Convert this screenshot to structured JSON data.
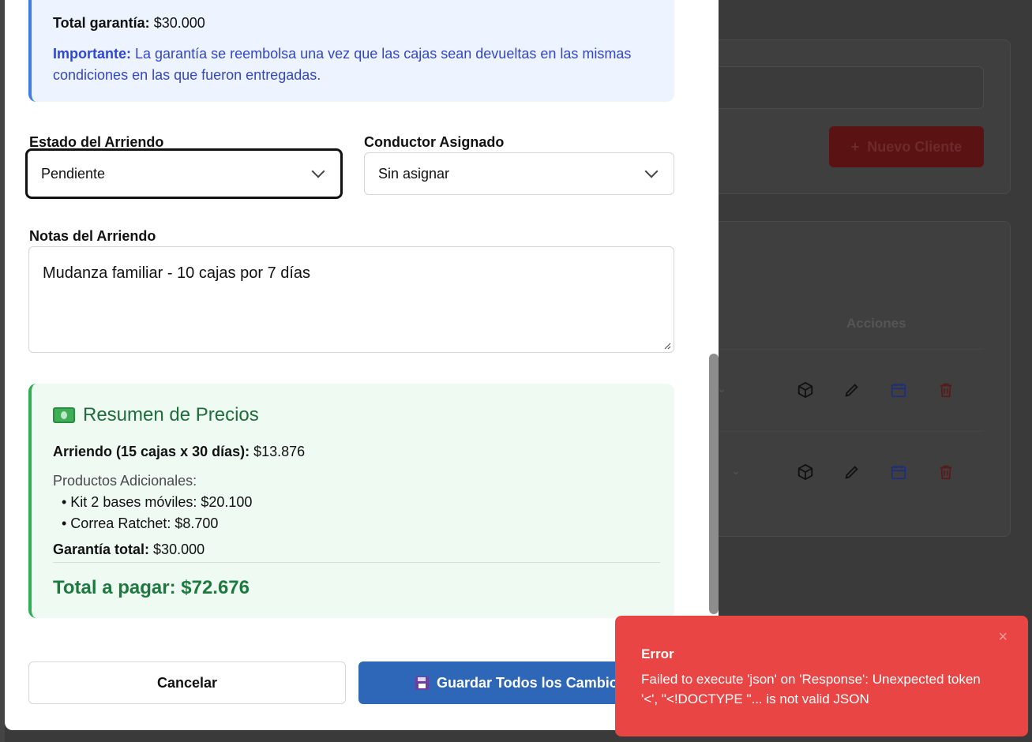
{
  "guarantee": {
    "total_label": "Total garantía:",
    "total_value": "$30.000",
    "important_label": "Importante:",
    "important_text": "La garantía se reembolsa una vez que las cajas sean devueltas en las mismas condiciones en las que fueron entregadas."
  },
  "form": {
    "estado_label": "Estado del Arriendo",
    "estado_value": "Pendiente",
    "conductor_label": "Conductor Asignado",
    "conductor_value": "Sin asignar",
    "notas_label": "Notas del Arriendo",
    "notas_value": "Mudanza familiar - 10 cajas por 7 días"
  },
  "summary": {
    "title": "Resumen de Precios",
    "arriendo_label": "Arriendo (15 cajas x 30 días):",
    "arriendo_value": "$13.876",
    "productos_label": "Productos Adicionales:",
    "items": [
      "• Kit 2 bases móviles: $20.100",
      "• Correa Ratchet: $8.700"
    ],
    "garantia_label": "Garantía total:",
    "garantia_value": "$30.000",
    "total_label": "Total a pagar: $72.676"
  },
  "actions": {
    "cancel_label": "Cancelar",
    "save_label": "Guardar Todos los Cambios"
  },
  "background": {
    "new_client_label": "Nuevo Cliente",
    "acciones_header": "Acciones"
  },
  "toast": {
    "title": "Error",
    "message": "Failed to execute 'json' on 'Response': Unexpected token '<', \"<!DOCTYPE \"... is not valid JSON",
    "close_symbol": "×"
  },
  "colors": {
    "primary": "#2f67b8",
    "error": "#e94545",
    "success": "#1d7a3f",
    "info": "#3f7be8"
  }
}
